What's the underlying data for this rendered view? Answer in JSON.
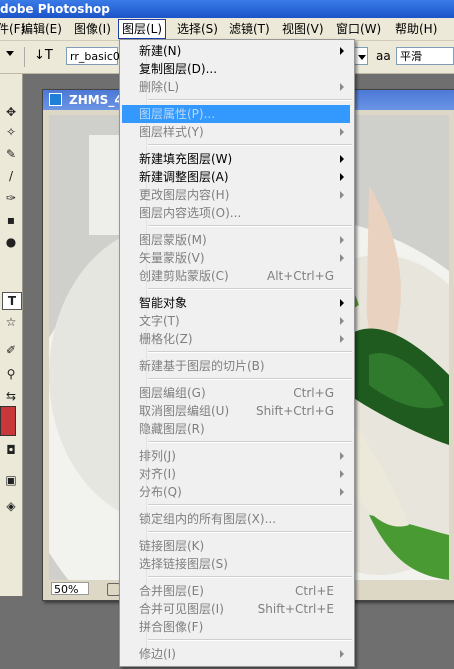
{
  "app": {
    "title": "dobe Photoshop"
  },
  "menubar": [
    {
      "label": "件(F)"
    },
    {
      "label": "编辑(E)"
    },
    {
      "label": "图像(I)"
    },
    {
      "label": "图层(L)"
    },
    {
      "label": "选择(S)"
    },
    {
      "label": "滤镜(T)"
    },
    {
      "label": "视图(V)"
    },
    {
      "label": "窗口(W)"
    },
    {
      "label": "帮助(H)"
    }
  ],
  "options_bar": {
    "font_family": "rr_basic0",
    "aa_icon": "aa",
    "anti_alias": "平滑"
  },
  "document": {
    "title": "ZHMS_4",
    "zoom": "50%"
  },
  "layer_menu": {
    "items": [
      {
        "label": "新建(N)",
        "shortcut": ""
      },
      {
        "label": "复制图层(D)...",
        "shortcut": ""
      },
      {
        "label": "删除(L)",
        "shortcut": ""
      },
      {
        "label": "图层属性(P)...",
        "shortcut": ""
      },
      {
        "label": "图层样式(Y)",
        "shortcut": ""
      },
      {
        "label": "新建填充图层(W)",
        "shortcut": ""
      },
      {
        "label": "新建调整图层(A)",
        "shortcut": ""
      },
      {
        "label": "更改图层内容(H)",
        "shortcut": ""
      },
      {
        "label": "图层内容选项(O)...",
        "shortcut": ""
      },
      {
        "label": "图层蒙版(M)",
        "shortcut": ""
      },
      {
        "label": "矢量蒙版(V)",
        "shortcut": ""
      },
      {
        "label": "创建剪贴蒙版(C)",
        "shortcut": "Alt+Ctrl+G"
      },
      {
        "label": "智能对象",
        "shortcut": ""
      },
      {
        "label": "文字(T)",
        "shortcut": ""
      },
      {
        "label": "栅格化(Z)",
        "shortcut": ""
      },
      {
        "label": "新建基于图层的切片(B)",
        "shortcut": ""
      },
      {
        "label": "图层编组(G)",
        "shortcut": "Ctrl+G"
      },
      {
        "label": "取消图层编组(U)",
        "shortcut": "Shift+Ctrl+G"
      },
      {
        "label": "隐藏图层(R)",
        "shortcut": ""
      },
      {
        "label": "排列(J)",
        "shortcut": ""
      },
      {
        "label": "对齐(I)",
        "shortcut": ""
      },
      {
        "label": "分布(Q)",
        "shortcut": ""
      },
      {
        "label": "锁定组内的所有图层(X)...",
        "shortcut": ""
      },
      {
        "label": "链接图层(K)",
        "shortcut": ""
      },
      {
        "label": "选择链接图层(S)",
        "shortcut": ""
      },
      {
        "label": "合并图层(E)",
        "shortcut": "Ctrl+E"
      },
      {
        "label": "合并可见图层(I)",
        "shortcut": "Shift+Ctrl+E"
      },
      {
        "label": "拼合图像(F)",
        "shortcut": ""
      },
      {
        "label": "修边(I)",
        "shortcut": ""
      }
    ]
  }
}
